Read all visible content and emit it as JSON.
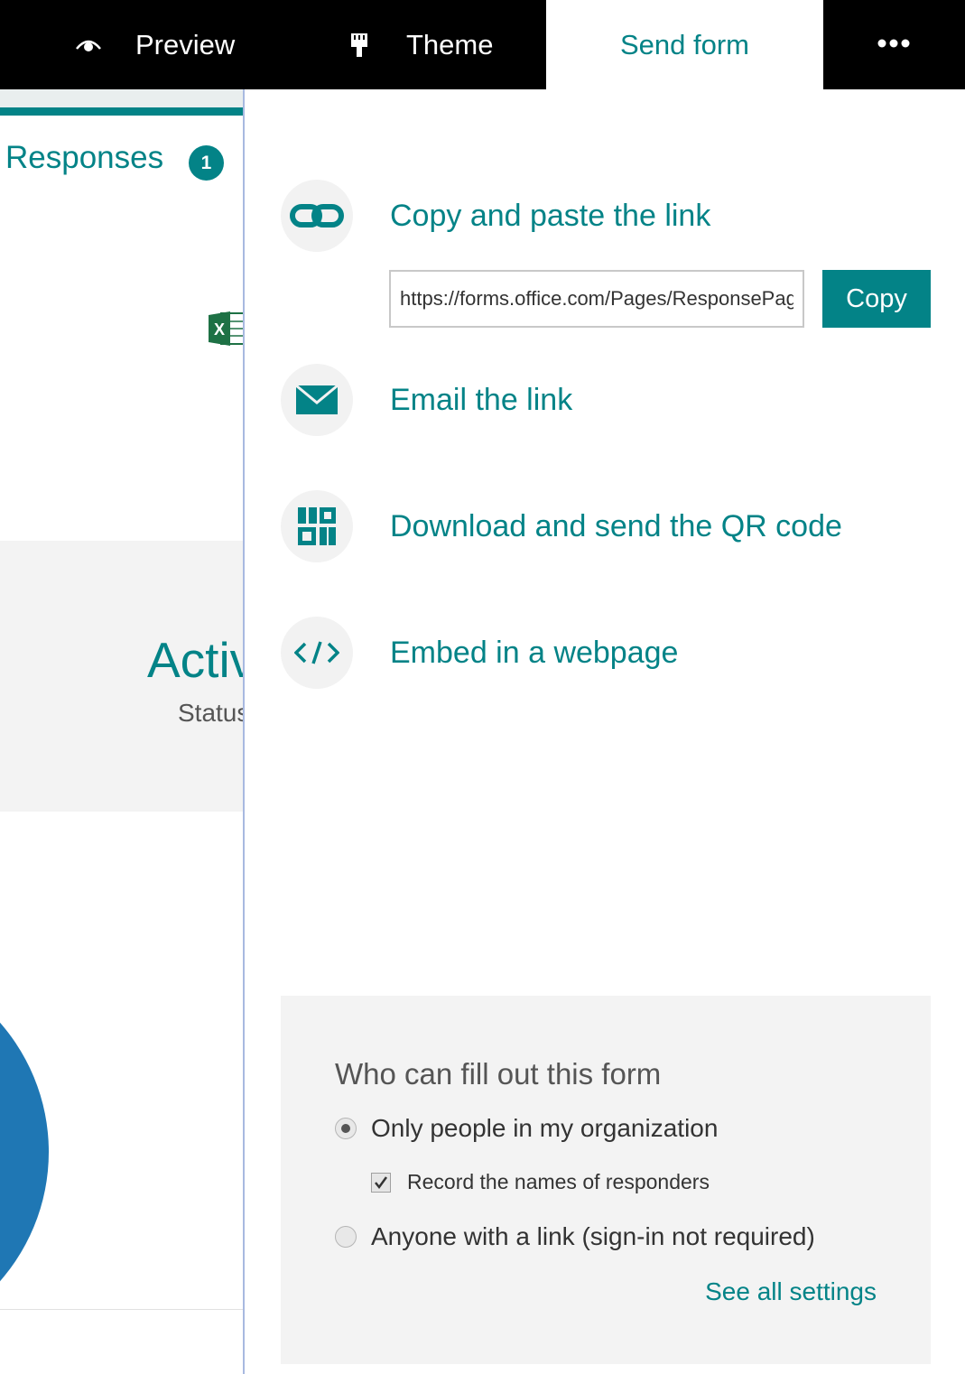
{
  "topbar": {
    "preview_label": "Preview",
    "theme_label": "Theme",
    "send_form_label": "Send form",
    "more_icon": "more-icon"
  },
  "background_page": {
    "responses_label": "Responses",
    "responses_count": "1",
    "active_text": "Activ",
    "status_text": "Status"
  },
  "send_panel": {
    "options": {
      "link": {
        "label": "Copy and paste the link",
        "icon": "link-icon"
      },
      "email": {
        "label": "Email the link",
        "icon": "mail-icon"
      },
      "qr": {
        "label": "Download and send the QR code",
        "icon": "qr-code-icon"
      },
      "embed": {
        "label": "Embed in a webpage",
        "icon": "code-icon"
      }
    },
    "link_value": "https://forms.office.com/Pages/ResponsePage",
    "copy_label": "Copy",
    "who": {
      "title": "Who can fill out this form",
      "org_label": "Only people in my organization",
      "org_selected": true,
      "record_label": "Record the names of responders",
      "record_checked": true,
      "anyone_label": "Anyone with a link (sign-in not required)",
      "anyone_selected": false,
      "see_all_label": "See all settings"
    }
  },
  "colors": {
    "accent": "#038387",
    "topbar": "#000000",
    "chart_blue": "#1f77b4"
  }
}
